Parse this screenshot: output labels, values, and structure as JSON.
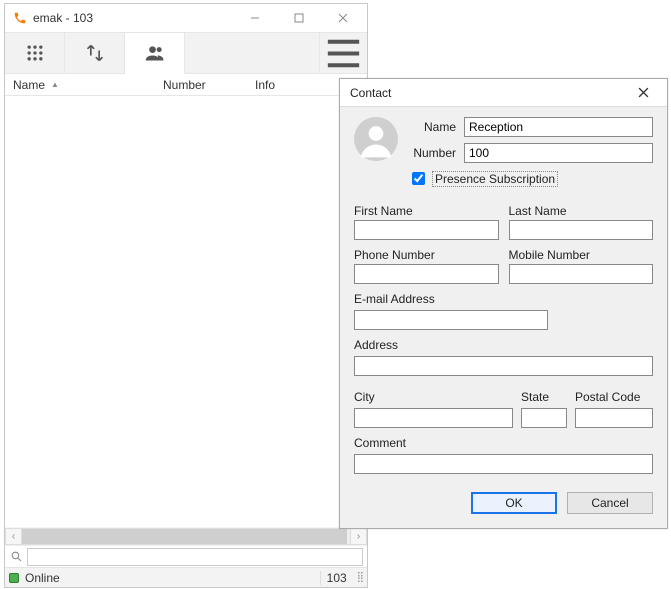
{
  "window": {
    "title": "emak - 103",
    "columns": {
      "name": "Name",
      "number": "Number",
      "info": "Info"
    },
    "search_value": "",
    "status": {
      "text": "Online",
      "extension": "103"
    }
  },
  "dialog": {
    "title": "Contact",
    "labels": {
      "name": "Name",
      "number": "Number",
      "presence": "Presence Subscription",
      "first_name": "First Name",
      "last_name": "Last Name",
      "phone": "Phone Number",
      "mobile": "Mobile Number",
      "email": "E-mail Address",
      "address": "Address",
      "city": "City",
      "state": "State",
      "postal": "Postal Code",
      "comment": "Comment"
    },
    "values": {
      "name": "Reception",
      "number": "100",
      "presence_checked": true,
      "first_name": "",
      "last_name": "",
      "phone": "",
      "mobile": "",
      "email": "",
      "address": "",
      "city": "",
      "state": "",
      "postal": "",
      "comment": ""
    },
    "buttons": {
      "ok": "OK",
      "cancel": "Cancel"
    }
  }
}
